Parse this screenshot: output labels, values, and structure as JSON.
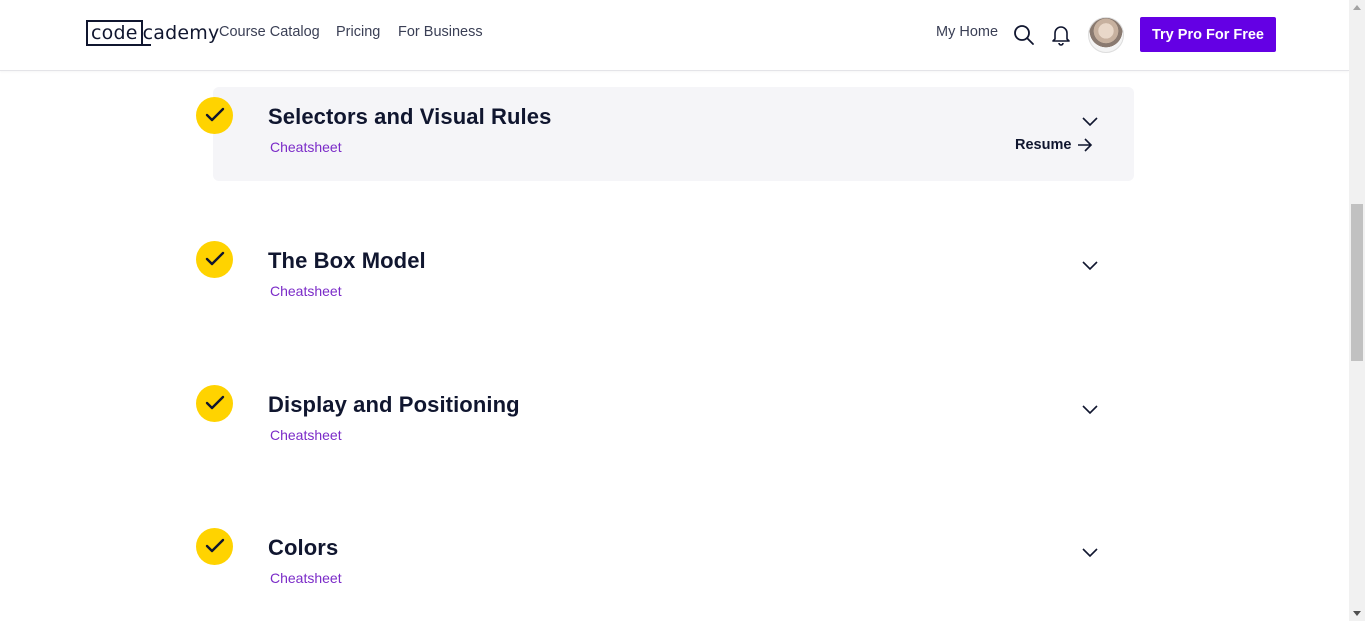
{
  "header": {
    "logo": {
      "boxed": "code",
      "rest": "cademy"
    },
    "nav": [
      {
        "label": "Course Catalog"
      },
      {
        "label": "Pricing"
      },
      {
        "label": "For Business"
      }
    ],
    "my_home": "My Home",
    "cta": "Try Pro For Free",
    "icons": [
      "search-icon",
      "bell-icon",
      "avatar"
    ],
    "colors": {
      "cta": "#6400e4",
      "check": "#ffd300",
      "link": "#7b2bc8"
    }
  },
  "modules": [
    {
      "title": "Selectors and Visual Rules",
      "subtitle": "Cheatsheet",
      "completed": true,
      "active": true,
      "resume": "Resume"
    },
    {
      "title": "The Box Model",
      "subtitle": "Cheatsheet",
      "completed": true,
      "active": false
    },
    {
      "title": "Display and Positioning",
      "subtitle": "Cheatsheet",
      "completed": true,
      "active": false
    },
    {
      "title": "Colors",
      "subtitle": "Cheatsheet",
      "completed": true,
      "active": false
    }
  ]
}
